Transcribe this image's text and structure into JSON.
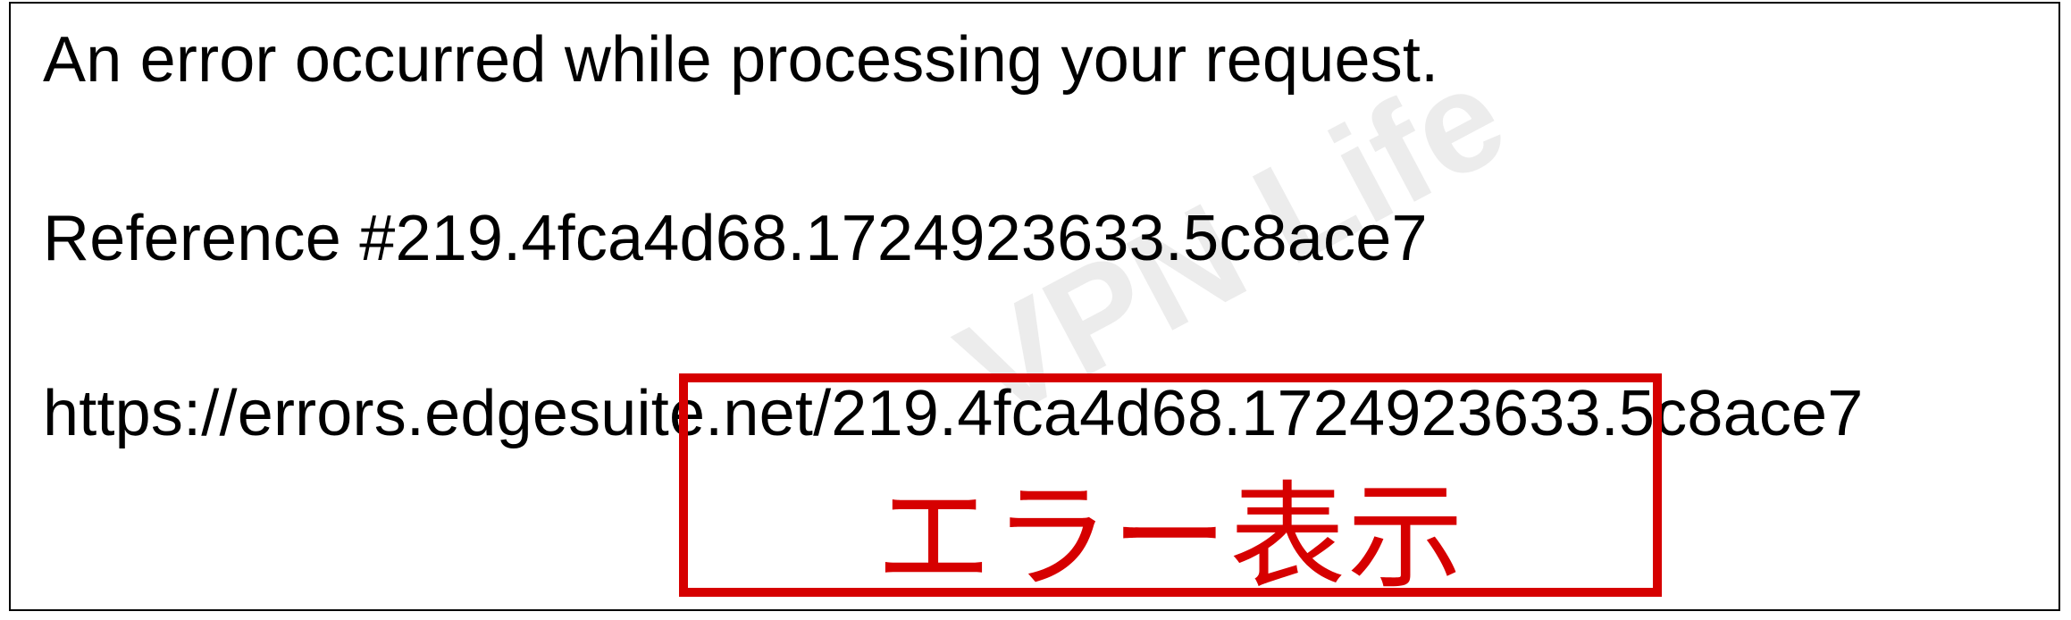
{
  "error": {
    "message": "An error occurred while processing your request.",
    "reference_line": "Reference #219.4fca4d68.1724923633.5c8ace7",
    "url": "https://errors.edgesuite.net/219.4fca4d68.1724923633.5c8ace7"
  },
  "watermark": "VPN Life",
  "annotation": {
    "label": "エラー表示"
  }
}
